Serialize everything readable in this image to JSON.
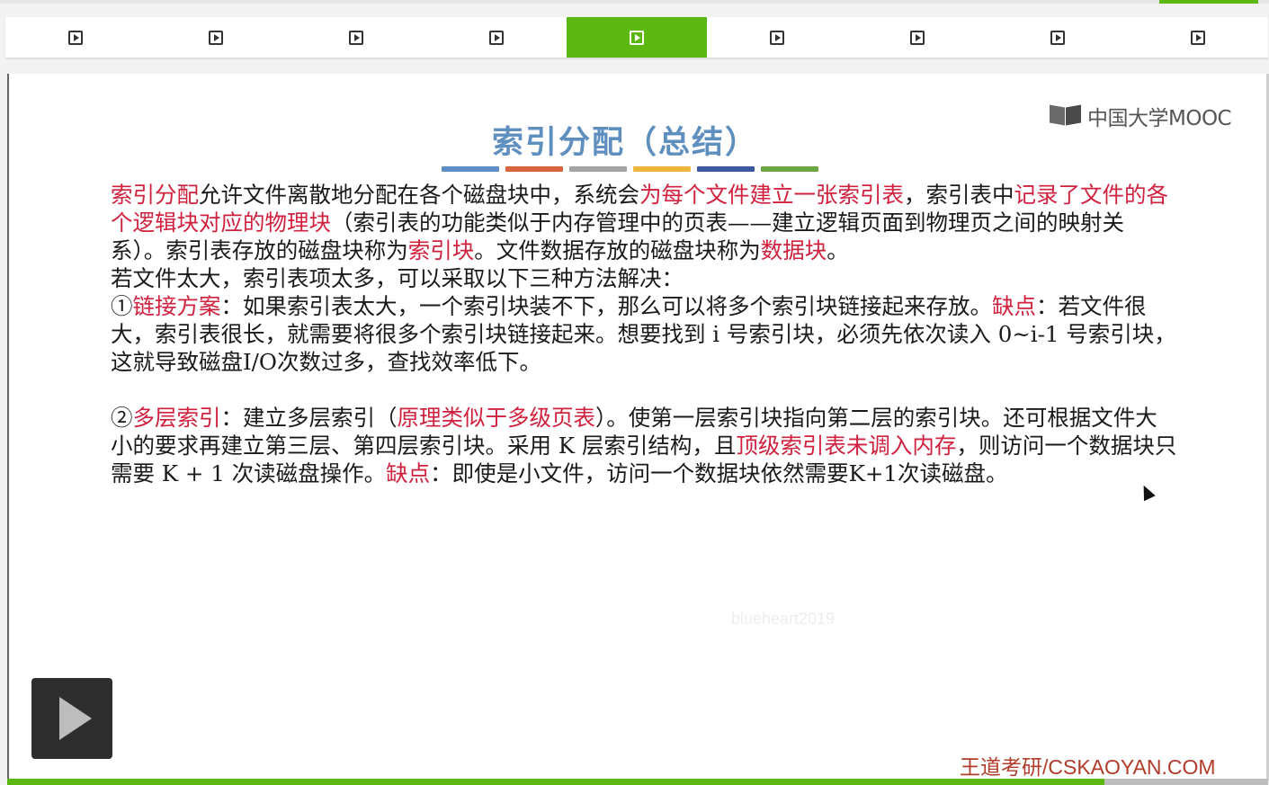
{
  "segments": {
    "count": 9,
    "active_index": 4
  },
  "slide": {
    "title": "索引分配（总结）",
    "logo_text": "中国大学MOOC",
    "title_bar_colors": [
      "#5b8fc5",
      "#d9653f",
      "#a3a3a3",
      "#efb43a",
      "#3c5aa0",
      "#6ba842"
    ],
    "paragraphs": [
      {
        "runs": [
          {
            "t": "索引分配",
            "h": true
          },
          {
            "t": "允许文件离散地分配在各个磁盘块中，系统会"
          },
          {
            "t": "为每个文件建立一张索引表",
            "h": true
          },
          {
            "t": "，索引表中"
          },
          {
            "t": "记录了文件的各个逻辑块对应的物理块",
            "h": true
          },
          {
            "t": "（索引表的功能类似于内存管理中的页表——建立逻辑页面到物理页之间的映射关系）。索引表存放的磁盘块称为"
          },
          {
            "t": "索引块",
            "h": true
          },
          {
            "t": "。文件数据存放的磁盘块称为"
          },
          {
            "t": "数据块",
            "h": true
          },
          {
            "t": "。"
          }
        ]
      },
      {
        "runs": [
          {
            "t": "若文件太大，索引表项太多，可以采取以下三种方法解决："
          }
        ]
      },
      {
        "runs": [
          {
            "t": "①"
          },
          {
            "t": "链接方案",
            "h": true
          },
          {
            "t": "：如果索引表太大，一个索引块装不下，那么可以将多个索引块链接起来存放。"
          },
          {
            "t": "缺点",
            "h": true
          },
          {
            "t": "：若文件很大，索引表很长，就需要将很多个索引块链接起来。想要找到 i 号索引块，必须先依次读入 0~i-1 号索引块，这就导致磁盘I/O次数过多，查找效率低下。"
          }
        ]
      },
      {
        "gap": true,
        "runs": [
          {
            "t": "②"
          },
          {
            "t": "多层索引",
            "h": true
          },
          {
            "t": "：建立多层索引（"
          },
          {
            "t": "原理类似于多级页表",
            "h": true
          },
          {
            "t": "）。使第一层索引块指向第二层的索引块。还可根据文件大小的要求再建立第三层、第四层索引块。采用 K 层索引结构，且"
          },
          {
            "t": "顶级索引表未调入内存",
            "h": true
          },
          {
            "t": "，则访问一个数据块只需要 K + 1 次读磁盘操作。"
          },
          {
            "t": "缺点",
            "h": true
          },
          {
            "t": "：即使是小文件，访问一个数据块依然需要K+1次读磁盘。"
          }
        ]
      }
    ],
    "watermark": "blueheart2019",
    "footer_brand": "王道考研/CSKAOYAN.COM"
  },
  "player": {
    "progress_fraction": 0.87
  },
  "colors": {
    "accent": "#5cb811",
    "highlight": "#d0213e",
    "title": "#5f8fbf"
  }
}
